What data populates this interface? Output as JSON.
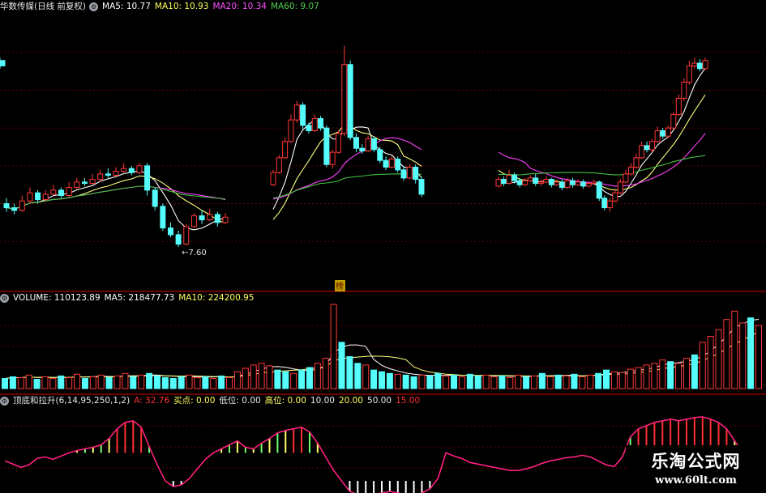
{
  "main_header": {
    "title": "华数传媒(日线 前复权)",
    "ma5": "MA5: 10.77",
    "ma10": "MA10: 10.93",
    "ma20": "MA20: 10.34",
    "ma60": "MA60: 9.07"
  },
  "volume_header": {
    "volume": "VOLUME: 110123.89",
    "ma5": "MA5: 218477.73",
    "ma10": "MA10: 224200.95"
  },
  "indicator_header": {
    "name": "顶底和拉升(6,14,95,250,1,2)",
    "a": "A: 32.76",
    "buy_point": "买点: 0.00",
    "low": "低位: 0.00",
    "high": "高位: 0.00",
    "l10": "10.00",
    "l20": "20.00",
    "l50": "50.00",
    "l15": "15.00"
  },
  "annotations": {
    "low_price": "←7.60",
    "marker": "榜"
  },
  "watermark": {
    "line1": "乐淘公式网",
    "line2": "www.60lt.com"
  },
  "colors": {
    "up": "#ff3838",
    "down": "#54fcfc",
    "ma5": "#ffffff",
    "ma10": "#ffff80",
    "ma20": "#ff40ff",
    "ma60": "#40c040",
    "grid": "#800000"
  },
  "chart_data": {
    "type": "candlestick",
    "price_range": [
      6.4,
      16.2
    ],
    "indicator_range": [
      -5,
      100
    ],
    "candles": [
      [
        9.2,
        9.05,
        9.4,
        8.9
      ],
      [
        9.05,
        8.95,
        9.2,
        8.8
      ],
      [
        8.95,
        9.3,
        9.5,
        8.9
      ],
      [
        9.3,
        9.6,
        9.8,
        9.2
      ],
      [
        9.6,
        9.35,
        9.7,
        9.2
      ],
      [
        9.35,
        9.55,
        9.7,
        9.3
      ],
      [
        9.55,
        9.7,
        9.9,
        9.5
      ],
      [
        9.7,
        9.5,
        9.8,
        9.4
      ],
      [
        9.5,
        9.8,
        10.0,
        9.45
      ],
      [
        9.8,
        10.0,
        10.15,
        9.75
      ],
      [
        10.0,
        9.95,
        10.15,
        9.85
      ],
      [
        9.95,
        10.1,
        10.3,
        9.9
      ],
      [
        10.1,
        10.3,
        10.45,
        10.0
      ],
      [
        10.3,
        10.25,
        10.5,
        10.15
      ],
      [
        10.25,
        10.4,
        10.55,
        10.2
      ],
      [
        10.4,
        10.5,
        10.7,
        10.35
      ],
      [
        10.5,
        10.35,
        10.6,
        10.25
      ],
      [
        10.35,
        10.6,
        10.7,
        10.3
      ],
      [
        10.6,
        9.7,
        10.7,
        9.5
      ],
      [
        9.7,
        9.1,
        9.8,
        8.95
      ],
      [
        9.1,
        8.3,
        9.2,
        8.2
      ],
      [
        8.3,
        8.05,
        8.5,
        7.95
      ],
      [
        8.05,
        7.7,
        8.2,
        7.6
      ],
      [
        7.7,
        8.35,
        8.45,
        7.65
      ],
      [
        8.35,
        8.75,
        8.85,
        8.3
      ],
      [
        8.75,
        8.6,
        8.95,
        8.45
      ],
      [
        8.6,
        8.8,
        9.0,
        8.55
      ],
      [
        8.8,
        8.5,
        8.9,
        8.35
      ],
      [
        8.5,
        8.7,
        8.85,
        8.45
      ],
      [
        9.9,
        10.35,
        10.45,
        9.85
      ],
      [
        10.35,
        10.9,
        11.0,
        10.3
      ],
      [
        10.9,
        11.5,
        11.65,
        10.85
      ],
      [
        11.5,
        12.3,
        12.5,
        11.45
      ],
      [
        12.3,
        12.85,
        13.0,
        12.2
      ],
      [
        12.85,
        12.1,
        12.95,
        11.95
      ],
      [
        12.1,
        11.9,
        12.2,
        11.8
      ],
      [
        11.9,
        12.35,
        12.5,
        11.85
      ],
      [
        12.35,
        12.0,
        12.45,
        11.9
      ],
      [
        12.0,
        10.65,
        12.1,
        10.55
      ],
      [
        10.65,
        11.1,
        11.2,
        10.5
      ],
      [
        11.1,
        11.8,
        11.9,
        11.05
      ],
      [
        11.8,
        14.35,
        15.05,
        11.7
      ],
      [
        14.35,
        11.65,
        14.5,
        11.55
      ],
      [
        11.65,
        11.25,
        11.8,
        11.1
      ],
      [
        11.25,
        11.15,
        11.4,
        11.05
      ],
      [
        11.15,
        11.6,
        11.7,
        11.1
      ],
      [
        11.6,
        11.2,
        11.7,
        11.1
      ],
      [
        11.2,
        10.8,
        11.3,
        10.7
      ],
      [
        10.8,
        10.55,
        10.95,
        10.45
      ],
      [
        10.55,
        10.85,
        10.95,
        10.5
      ],
      [
        10.85,
        10.45,
        10.95,
        10.35
      ],
      [
        10.45,
        10.15,
        10.55,
        10.05
      ],
      [
        10.15,
        10.55,
        10.65,
        10.1
      ],
      [
        10.55,
        10.1,
        10.65,
        9.95
      ],
      [
        10.1,
        9.55,
        10.2,
        9.45
      ],
      [
        9.85,
        10.1,
        10.2,
        9.8
      ],
      [
        10.1,
        9.95,
        10.2,
        9.85
      ],
      [
        9.95,
        10.25,
        10.45,
        9.9
      ],
      [
        10.25,
        10.05,
        10.35,
        9.95
      ],
      [
        10.05,
        9.9,
        10.15,
        9.8
      ],
      [
        9.9,
        10.05,
        10.15,
        9.85
      ],
      [
        10.05,
        10.15,
        10.25,
        10.0
      ],
      [
        10.15,
        9.95,
        10.3,
        9.85
      ],
      [
        9.95,
        10.0,
        10.1,
        9.85
      ],
      [
        10.0,
        10.1,
        10.2,
        9.95
      ],
      [
        10.1,
        9.9,
        10.15,
        9.8
      ],
      [
        9.9,
        10.0,
        10.1,
        9.85
      ],
      [
        10.0,
        9.8,
        10.1,
        9.7
      ],
      [
        9.8,
        10.05,
        10.15,
        9.75
      ],
      [
        10.05,
        9.9,
        10.15,
        9.8
      ],
      [
        9.9,
        10.0,
        10.1,
        9.85
      ],
      [
        10.0,
        9.85,
        10.1,
        9.75
      ],
      [
        9.85,
        9.95,
        10.05,
        9.8
      ],
      [
        9.95,
        10.0,
        10.1,
        9.9
      ],
      [
        10.0,
        9.4,
        10.05,
        9.3
      ],
      [
        9.4,
        9.05,
        9.5,
        8.95
      ],
      [
        9.05,
        9.3,
        9.4,
        8.9
      ],
      [
        9.3,
        9.6,
        9.7,
        9.25
      ],
      [
        9.6,
        10.0,
        10.1,
        9.55
      ],
      [
        10.0,
        10.3,
        10.45,
        9.95
      ],
      [
        10.3,
        10.55,
        10.7,
        10.25
      ],
      [
        10.55,
        10.9,
        11.05,
        10.5
      ],
      [
        10.9,
        11.35,
        11.5,
        10.85
      ],
      [
        11.35,
        11.2,
        11.5,
        11.1
      ],
      [
        11.2,
        11.5,
        11.6,
        11.1
      ],
      [
        11.5,
        11.9,
        12.05,
        11.45
      ],
      [
        11.9,
        11.7,
        12.0,
        11.6
      ],
      [
        11.7,
        12.0,
        12.1,
        11.65
      ],
      [
        12.0,
        12.5,
        12.6,
        11.95
      ],
      [
        12.5,
        13.1,
        13.25,
        12.45
      ],
      [
        13.1,
        13.7,
        13.85,
        13.0
      ],
      [
        13.7,
        14.3,
        14.5,
        13.6
      ],
      [
        14.3,
        14.4,
        14.6,
        14.2
      ],
      [
        14.4,
        14.2,
        14.55,
        14.1
      ],
      [
        14.2,
        14.5,
        14.6,
        14.15
      ],
      [
        14.5,
        14.3,
        14.6,
        14.2
      ]
    ],
    "volume": [
      12,
      14,
      13,
      16,
      11,
      14,
      12,
      15,
      13,
      17,
      12,
      14,
      16,
      13,
      15,
      18,
      14,
      16,
      18,
      15,
      13,
      12,
      14,
      16,
      13,
      14,
      12,
      15,
      13,
      20,
      24,
      28,
      30,
      27,
      22,
      20,
      18,
      22,
      25,
      30,
      36,
      100,
      55,
      38,
      30,
      28,
      22,
      20,
      18,
      17,
      16,
      14,
      16,
      15,
      18,
      15,
      16,
      14,
      17,
      15,
      16,
      14,
      15,
      13,
      16,
      14,
      15,
      18,
      14,
      16,
      15,
      17,
      14,
      16,
      18,
      22,
      20,
      19,
      23,
      25,
      28,
      30,
      34,
      32,
      30,
      36,
      40,
      55,
      62,
      70,
      82,
      92,
      78,
      84,
      75
    ],
    "indicator_a": [
      30,
      26,
      22,
      25,
      33,
      35,
      32,
      36,
      40,
      43,
      45,
      47,
      50,
      58,
      70,
      78,
      80,
      72,
      48,
      25,
      5,
      -2,
      0,
      8,
      20,
      32,
      40,
      45,
      50,
      55,
      47,
      45,
      52,
      58,
      65,
      68,
      70,
      72,
      66,
      52,
      35,
      18,
      5,
      -8,
      -12,
      -14,
      -12,
      -10,
      -8,
      -10,
      -12,
      -14,
      -10,
      -5,
      8,
      40,
      36,
      33,
      28,
      26,
      24,
      22,
      20,
      18,
      18,
      20,
      23,
      27,
      30,
      32,
      34,
      35,
      37,
      35,
      30,
      25,
      23,
      35,
      60,
      70,
      74,
      78,
      80,
      82,
      80,
      82,
      84,
      85,
      82,
      78,
      70,
      55,
      40,
      28,
      25
    ]
  }
}
